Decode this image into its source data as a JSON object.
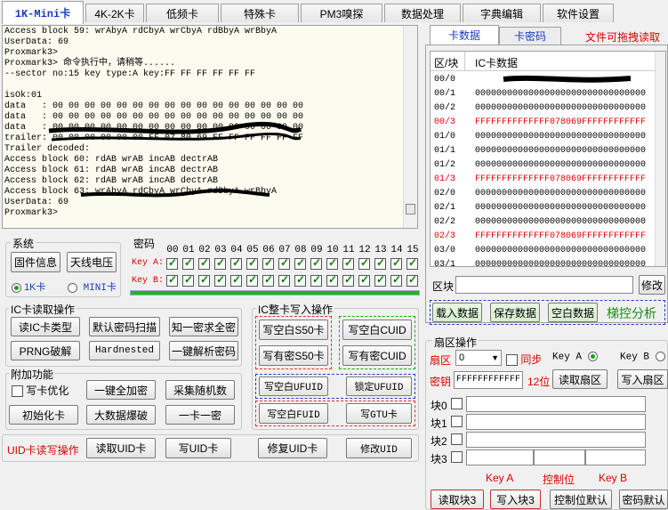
{
  "tabs": [
    "1K-Mini卡",
    "4K-2K卡",
    "低频卡",
    "特殊卡",
    "PM3嗅探",
    "数据处理",
    "字典编辑",
    "软件设置"
  ],
  "log": {
    "lines": [
      "Access block 59: wrAbyA rdCbyA wrCbyA rdBbyA wrBbyA",
      "UserData: 69",
      "Proxmark3>",
      "Proxmark3> 命令执行中，请稍等......",
      "--sector no:15 key type:A key:FF FF FF FF FF FF",
      "",
      "isOk:01",
      "data   : 00 00 00 00 00 00 00 00 00 00 00 00 00 00 00 00",
      "data   : 00 00 00 00 00 00 00 00 00 00 00 00 00 00 00 00",
      "data   : 00 00 00 00 00 00 00 00 00 00 00 00 00 00 00 00",
      "trailer: 00 00 00 00 00 00 FF 07 80 69 FF FF FF FF FF FF",
      "Trailer decoded:",
      "Access block 60: rdAB wrAB incAB dectrAB",
      "Access block 61: rdAB wrAB incAB dectrAB",
      "Access block 62: rdAB wrAB incAB dectrAB",
      "Access block 63: wrAbyA rdCbyA wrCbyA rdBbyA wrBbyA",
      "UserData: 69",
      "Proxmark3>"
    ]
  },
  "system": {
    "title": "系统",
    "firmware": "固件信息",
    "antenna": "天线电压",
    "radio_1k": "1K卡",
    "radio_mini": "MINI卡"
  },
  "keys": {
    "title": "密码",
    "columns": [
      "00",
      "01",
      "02",
      "03",
      "04",
      "05",
      "06",
      "07",
      "08",
      "09",
      "10",
      "11",
      "12",
      "13",
      "14",
      "15"
    ],
    "key_a": "Key A:",
    "key_b": "Key B:"
  },
  "read_ops": {
    "title": "IC卡读取操作",
    "btns": [
      "读IC卡类型",
      "默认密码扫描",
      "知一密求全密",
      "PRNG破解",
      "Hardnested",
      "一键解析密码"
    ]
  },
  "extra": {
    "title": "附加功能",
    "write_opt": "写卡优化",
    "encrypt": "一键全加密",
    "collect": "采集随机数",
    "init": "初始化卡",
    "big_data": "大数据爆破",
    "one_card": "一卡一密"
  },
  "write_ops": {
    "title": "IC整卡写入操作",
    "s50_blank": "写空白S50卡",
    "cuid_blank": "写空白CUID",
    "s50_key": "写有密S50卡",
    "cuid_key": "写有密CUID",
    "ufuid_blank": "写空白UFUID",
    "ufuid_lock": "锁定UFUID",
    "fuid_blank": "写空白FUID",
    "gtu": "写GTU卡"
  },
  "uid": {
    "title": "UID卡读写操作",
    "read": "读取UID卡",
    "write": "写UID卡",
    "repair": "修复UID卡",
    "modify": "修改UID"
  },
  "card_tabs": {
    "data": "卡数据",
    "key": "卡密码",
    "drag": "文件可拖拽读取"
  },
  "table": {
    "col1": "区/块",
    "col2": "IC卡数据",
    "rows": [
      {
        "b": "00/0",
        "d": "",
        "red": false,
        "redacted": true
      },
      {
        "b": "00/1",
        "d": "00000000000000000000000000000000",
        "red": false
      },
      {
        "b": "00/2",
        "d": "00000000000000000000000000000000",
        "red": false
      },
      {
        "b": "00/3",
        "d": "FFFFFFFFFFFFFF078069FFFFFFFFFFFF",
        "red": true
      },
      {
        "b": "01/0",
        "d": "00000000000000000000000000000000",
        "red": false
      },
      {
        "b": "01/1",
        "d": "00000000000000000000000000000000",
        "red": false
      },
      {
        "b": "01/2",
        "d": "00000000000000000000000000000000",
        "red": false
      },
      {
        "b": "01/3",
        "d": "FFFFFFFFFFFFFF078069FFFFFFFFFFFF",
        "red": true
      },
      {
        "b": "02/0",
        "d": "00000000000000000000000000000000",
        "red": false
      },
      {
        "b": "02/1",
        "d": "00000000000000000000000000000000",
        "red": false
      },
      {
        "b": "02/2",
        "d": "00000000000000000000000000000000",
        "red": false
      },
      {
        "b": "02/3",
        "d": "FFFFFFFFFFFFFF078069FFFFFFFFFFFF",
        "red": true
      },
      {
        "b": "03/0",
        "d": "00000000000000000000000000000000",
        "red": false
      },
      {
        "b": "03/1",
        "d": "00000000000000000000000000000000",
        "red": false
      }
    ]
  },
  "block_edit": {
    "label": "区块",
    "modify": "修改"
  },
  "data_btns": {
    "load": "载入数据",
    "save": "保存数据",
    "blank": "空白数据",
    "analyze": "梯控分析"
  },
  "sector": {
    "title": "扇区操作",
    "sector_label": "扇区",
    "sector_value": "0",
    "sync": "同步",
    "keya": "Key A",
    "keyb": "Key B",
    "key_label": "密钥",
    "key_value": "FFFFFFFFFFFF",
    "bits": "12位",
    "read": "读取扇区",
    "write": "写入扇区",
    "blocks": [
      "块0",
      "块1",
      "块2",
      "块3"
    ],
    "keya_hdr": "Key A",
    "ctrl_hdr": "控制位",
    "keyb_hdr": "Key B",
    "read3": "读取块3",
    "write3": "写入块3",
    "ctrl_default": "控制位默认",
    "key_default": "密码默认"
  }
}
